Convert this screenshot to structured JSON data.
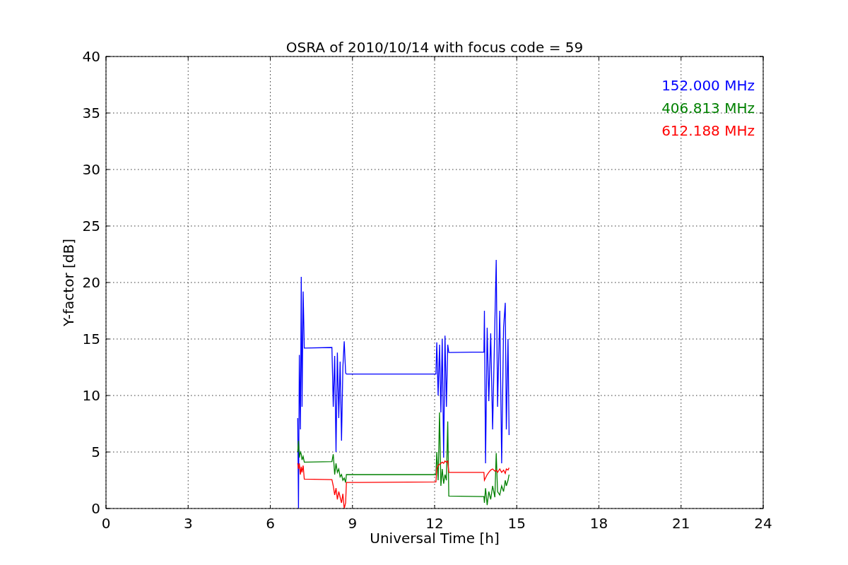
{
  "chart_data": {
    "type": "line",
    "title": "OSRA of 2010/10/14 with focus code = 59",
    "xlabel": "Universal Time [h]",
    "ylabel": "Y-factor [dB]",
    "grid": true,
    "xlim": [
      0,
      24
    ],
    "ylim": [
      0,
      40
    ],
    "xticks": [
      0,
      3,
      6,
      9,
      12,
      15,
      18,
      21,
      24
    ],
    "yticks": [
      0,
      5,
      10,
      15,
      20,
      25,
      30,
      35,
      40
    ],
    "x": [
      7.0,
      7.03,
      7.06,
      7.1,
      7.13,
      7.16,
      7.2,
      7.24,
      8.25,
      8.3,
      8.35,
      8.4,
      8.45,
      8.5,
      8.55,
      8.6,
      8.65,
      8.7,
      8.75,
      8.78,
      12.05,
      12.08,
      12.13,
      12.18,
      12.23,
      12.28,
      12.33,
      12.38,
      12.43,
      12.48,
      12.52,
      13.8,
      13.82,
      13.86,
      13.92,
      13.98,
      14.05,
      14.12,
      14.2,
      14.25,
      14.3,
      14.38,
      14.45,
      14.52,
      14.58,
      14.62,
      14.68,
      14.72
    ],
    "series": [
      {
        "name": "152.000 MHz",
        "color": "#0000ff",
        "values": [
          8,
          0,
          13.6,
          7,
          20.5,
          9,
          19.2,
          14.2,
          14.25,
          9,
          13.5,
          5,
          13.8,
          8,
          13,
          6,
          12.5,
          14.8,
          12,
          11.9,
          11.9,
          14.7,
          10,
          14.5,
          8.5,
          15,
          4.5,
          15.3,
          9,
          14.5,
          13.8,
          13.85,
          17.5,
          4,
          16,
          9.5,
          15.5,
          7,
          16.5,
          22,
          9,
          17.5,
          4,
          16,
          18.2,
          7,
          15,
          6.5
        ]
      },
      {
        "name": "406.813 MHz",
        "color": "#008000",
        "values": [
          5,
          6,
          4.5,
          5,
          4.8,
          4.3,
          4.6,
          4.1,
          4.15,
          4.8,
          3,
          4,
          3.2,
          3.5,
          2.8,
          3,
          2.5,
          2.7,
          2.3,
          3.0,
          3.0,
          5,
          2.5,
          8.5,
          2,
          3.5,
          2.2,
          3,
          2.5,
          7.7,
          1.1,
          1.05,
          0.5,
          1.8,
          0.3,
          1.5,
          0.8,
          2,
          1,
          4.9,
          1.5,
          1.2,
          2,
          1.5,
          2.5,
          2,
          2.5,
          3
        ]
      },
      {
        "name": "612.188 MHz",
        "color": "#ff0000",
        "values": [
          4,
          3.5,
          4,
          3,
          3.7,
          3.2,
          3.8,
          2.6,
          2.55,
          2.0,
          1.2,
          1.8,
          0.8,
          1.5,
          1.0,
          0.5,
          1.3,
          0,
          0.5,
          2.3,
          2.35,
          3.5,
          3.8,
          3.9,
          4.0,
          4.1,
          4.0,
          4.2,
          4.1,
          4.2,
          3.2,
          3.2,
          2.5,
          2.7,
          3.0,
          3.2,
          3.4,
          3.5,
          3.3,
          3.4,
          3.2,
          3.5,
          3.2,
          3.4,
          3.1,
          3.5,
          3.4,
          3.6
        ]
      }
    ]
  }
}
